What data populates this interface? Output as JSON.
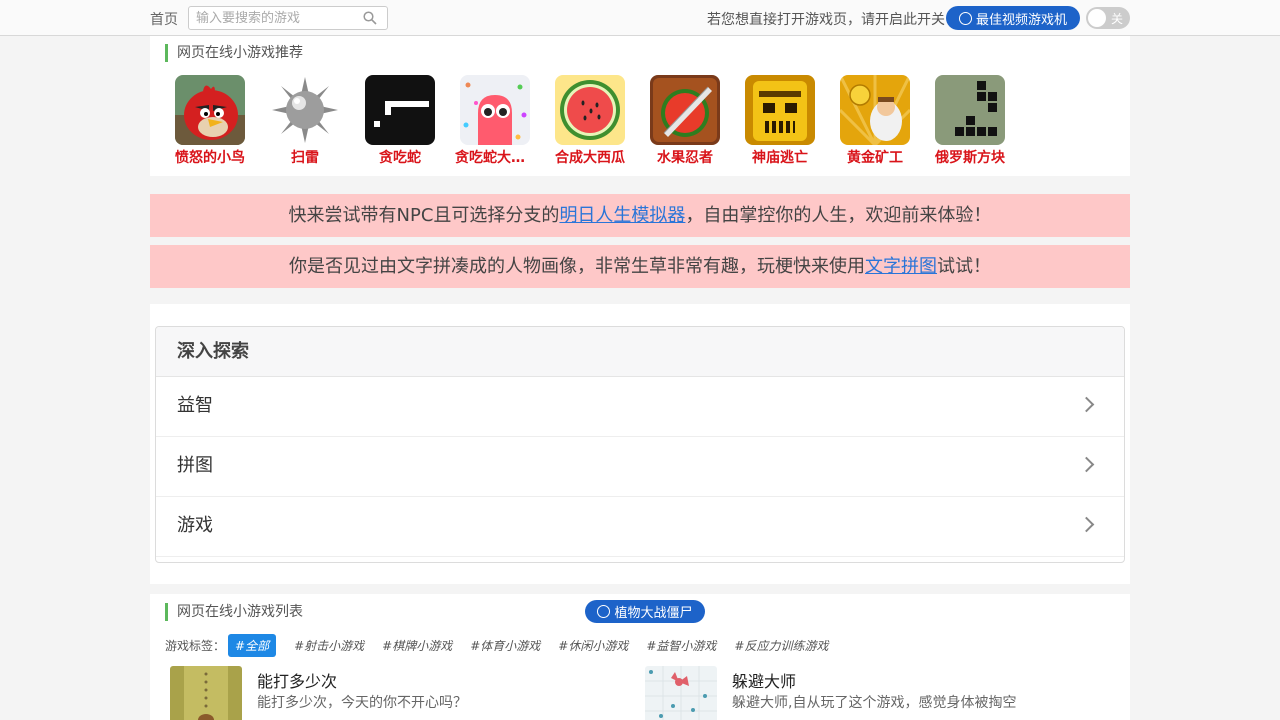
{
  "header": {
    "home_label": "首页",
    "search_placeholder": "输入要搜索的游戏",
    "hint": "若您想直接打开游戏页，请开启此开关",
    "best_button": "最佳视频游戏机",
    "toggle_label": "关",
    "toggle_on": false
  },
  "recommend": {
    "title": "网页在线小游戏推荐",
    "games": [
      {
        "name": "愤怒的小鸟",
        "icon": "angry-bird-icon"
      },
      {
        "name": "扫雷",
        "icon": "mine-icon"
      },
      {
        "name": "贪吃蛇",
        "icon": "snake-icon"
      },
      {
        "name": "贪吃蛇大作战",
        "icon": "snake-battle-icon"
      },
      {
        "name": "合成大西瓜",
        "icon": "watermelon-icon"
      },
      {
        "name": "水果忍者",
        "icon": "fruit-ninja-icon"
      },
      {
        "name": "神庙逃亡",
        "icon": "temple-run-icon"
      },
      {
        "name": "黄金矿工",
        "icon": "gold-miner-icon"
      },
      {
        "name": "俄罗斯方块",
        "icon": "tetris-icon"
      }
    ]
  },
  "banners": [
    {
      "before": "快来尝试带有NPC且可选择分支的",
      "link": "明日人生模拟器",
      "after": "，自由掌控你的人生，欢迎前来体验！"
    },
    {
      "before": "你是否见过由文字拼凑成的人物画像，非常生草非常有趣，玩梗快来使用",
      "link": "文字拼图",
      "after": "试试！"
    }
  ],
  "explore": {
    "title": "深入探索",
    "items": [
      "益智",
      "拼图",
      "游戏"
    ]
  },
  "list": {
    "title": "网页在线小游戏列表",
    "pvz_button": "植物大战僵尸",
    "tags_label": "游戏标签：",
    "tags": [
      "#全部",
      "#射击小游戏",
      "#棋牌小游戏",
      "#体育小游戏",
      "#休闲小游戏",
      "#益智小游戏",
      "#反应力训练游戏"
    ],
    "active_tag": 0,
    "items": [
      {
        "title": "能打多少次",
        "desc": "能打多少次，今天的你不开心吗？"
      },
      {
        "title": "躲避大师",
        "desc": "躲避大师,自从玩了这个游戏，感觉身体被掏空"
      }
    ]
  },
  "colors": {
    "accent_blue": "#1d63c9",
    "game_name_red": "#d9141a",
    "banner_pink": "#fec8c8",
    "link_blue": "#2a75d8",
    "title_bar_green": "#5cb85c"
  }
}
